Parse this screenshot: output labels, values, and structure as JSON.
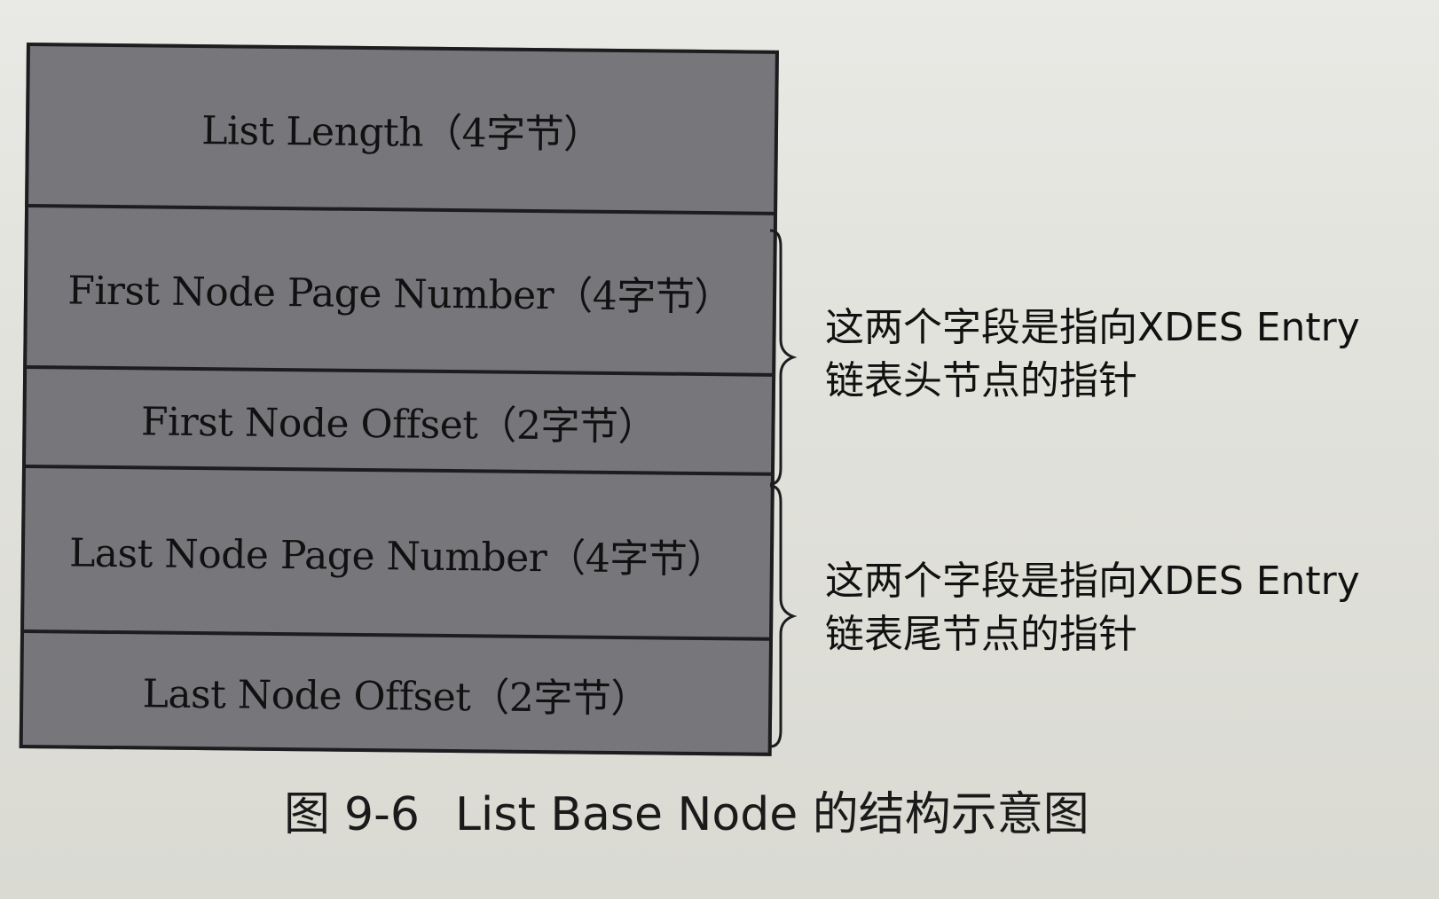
{
  "diagram": {
    "fields": [
      {
        "label": "List Length（4字节）"
      },
      {
        "label": "First Node Page Number（4字节）"
      },
      {
        "label": "First Node Offset（2字节）"
      },
      {
        "label": "Last Node Page Number（4字节）"
      },
      {
        "label": "Last Node Offset（2字节）"
      }
    ],
    "annotations": [
      {
        "line1": "这两个字段是指向XDES Entry",
        "line2": "链表头节点的指针"
      },
      {
        "line1": "这两个字段是指向XDES Entry",
        "line2": "链表尾节点的指针"
      }
    ],
    "caption": {
      "figure": "图",
      "number": "9-6",
      "title": "List Base Node 的结构示意图"
    },
    "colors": {
      "field_fill": "#77767a",
      "border": "#1d1d1f",
      "paper": "#e2e2dc"
    }
  }
}
